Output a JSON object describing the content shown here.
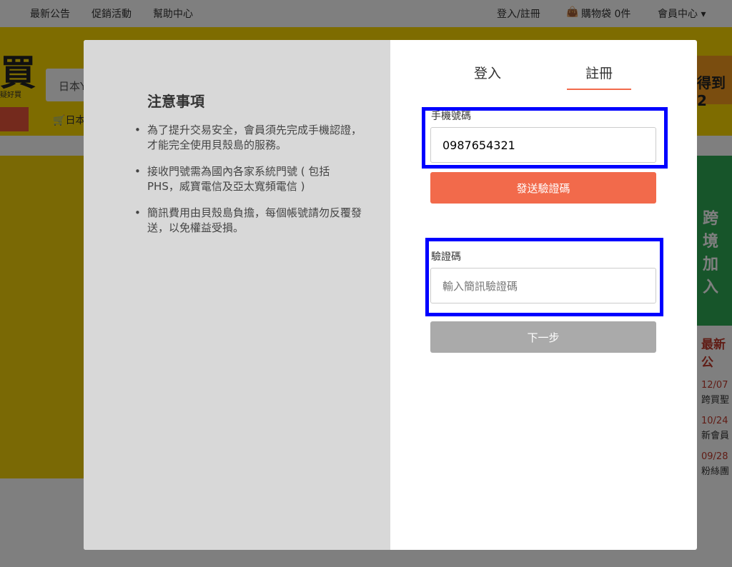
{
  "topbar": {
    "announcements": "最新公告",
    "promotions": "促銷活動",
    "help": "幫助中心",
    "login_register": "登入/註冊",
    "cart": "購物袋 0件",
    "member_center": "會員中心 ▾"
  },
  "header": {
    "logo": "買",
    "logo_sub": "疑好買",
    "search_value": "日本Y",
    "cart_link": "日本",
    "promo": "得到2"
  },
  "banner_right": {
    "text": "跨境加入"
  },
  "news": {
    "title": "最新公",
    "items": [
      {
        "date": "12/07",
        "text": "跨買聖"
      },
      {
        "date": "10/24",
        "text": "新會員"
      },
      {
        "date": "09/28",
        "text": "粉絲團"
      }
    ]
  },
  "modal": {
    "notice_title": "注意事項",
    "notices": [
      "為了提升交易安全，會員須先完成手機認證，才能完全使用貝殼島的服務。",
      "接收門號需為國內各家系統門號 ( 包括PHS，威寶電信及亞太寬頻電信 )",
      "簡訊費用由貝殼島負擔，每個帳號請勿反覆發送，以免權益受損。"
    ],
    "tabs": [
      {
        "label": "登入"
      },
      {
        "label": "註冊",
        "active": true
      }
    ],
    "phone_label": "手機號碼",
    "phone_value": "0987654321",
    "send_code_button": "發送驗證碼",
    "code_label": "驗證碼",
    "code_placeholder": "輸入簡訊驗證碼",
    "next_button": "下一步"
  },
  "colors": {
    "accent": "#f26a4b",
    "highlight": "#0000ff",
    "disabled_button": "#aaaaaa"
  }
}
